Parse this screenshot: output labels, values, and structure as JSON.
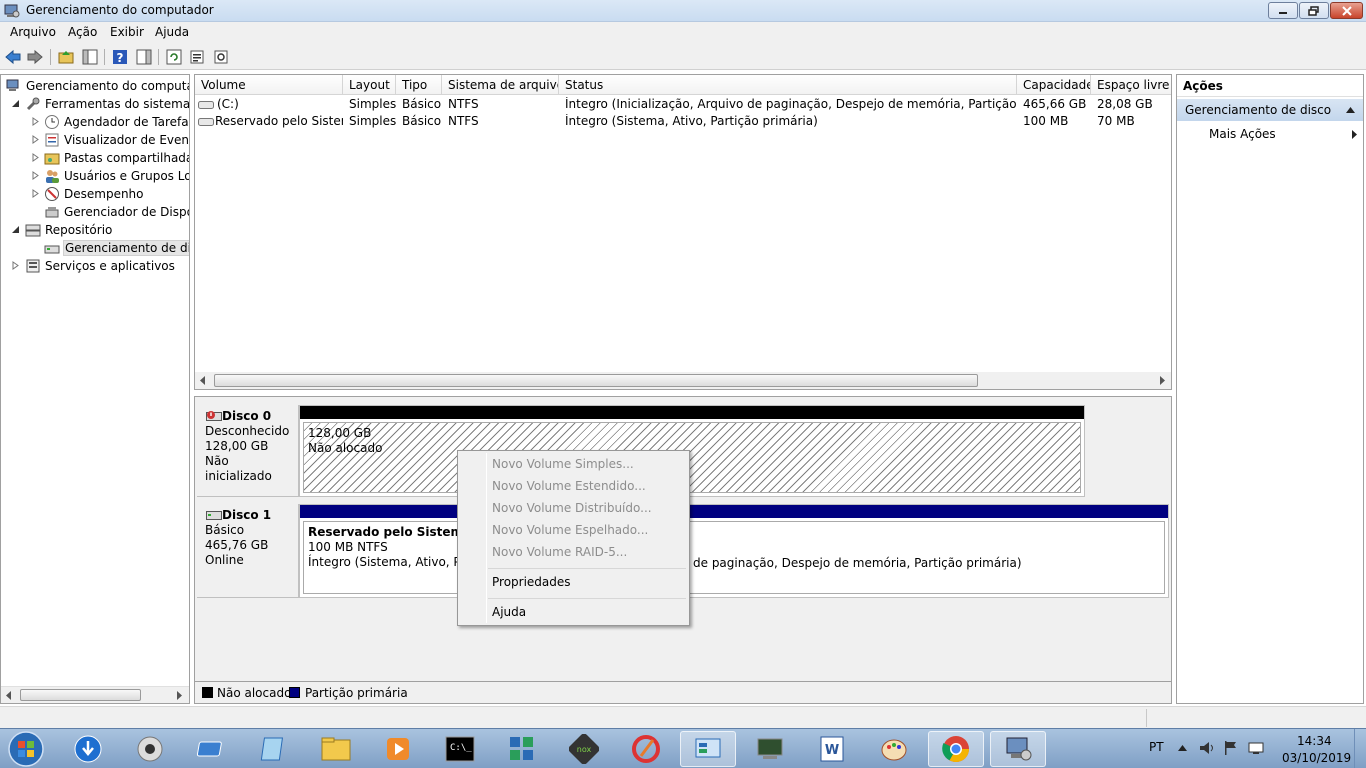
{
  "window": {
    "title": "Gerenciamento do computador"
  },
  "menu": [
    "Arquivo",
    "Ação",
    "Exibir",
    "Ajuda"
  ],
  "tree": {
    "root": "Gerenciamento do computador (Local)",
    "system_tools": "Ferramentas do sistema",
    "task_scheduler": "Agendador de Tarefas",
    "event_viewer": "Visualizador de Eventos",
    "shared_folders": "Pastas compartilhadas",
    "local_users": "Usuários e Grupos Locais",
    "performance": "Desempenho",
    "device_manager": "Gerenciador de Dispositivos",
    "storage": "Repositório",
    "disk_management": "Gerenciamento de disco",
    "services": "Serviços e aplicativos"
  },
  "volumes": {
    "columns": [
      "Volume",
      "Layout",
      "Tipo",
      "Sistema de arquivos",
      "Status",
      "Capacidade",
      "Espaço livre"
    ],
    "rows": [
      {
        "volume": "(C:)",
        "layout": "Simples",
        "type": "Básico",
        "fs": "NTFS",
        "status": "Íntegro (Inicialização, Arquivo de paginação, Despejo de memória, Partição primária)",
        "capacity": "465,66 GB",
        "free": "28,08 GB"
      },
      {
        "volume": "Reservado pelo Sistema",
        "layout": "Simples",
        "type": "Básico",
        "fs": "NTFS",
        "status": "Íntegro (Sistema, Ativo, Partição primária)",
        "capacity": "100 MB",
        "free": "70 MB"
      }
    ]
  },
  "disks": [
    {
      "name": "Disco 0",
      "kind": "Desconhecido",
      "size": "128,00 GB",
      "state": "Não inicializado",
      "part_size": "128,00 GB",
      "part_label": "Não alocado"
    },
    {
      "name": "Disco 1",
      "kind": "Básico",
      "size": "465,76 GB",
      "state": "Online",
      "part_name": "Reservado pelo Sistema",
      "part_size": "100 MB NTFS",
      "part_status": "Íntegro (Sistema, Ativo, Partição primária)",
      "part2_status": "de paginação, Despejo de memória, Partição primária)"
    }
  ],
  "legend": {
    "unallocated": "Não alocado",
    "primary": "Partição primária"
  },
  "actions": {
    "header": "Ações",
    "group": "Gerenciamento de disco",
    "more": "Mais Ações"
  },
  "context_menu": {
    "items": [
      "Novo Volume Simples...",
      "Novo Volume Estendido...",
      "Novo Volume Distribuído...",
      "Novo Volume Espelhado...",
      "Novo Volume RAID-5..."
    ],
    "properties": "Propriedades",
    "help": "Ajuda"
  },
  "tray": {
    "lang": "PT",
    "time": "14:34",
    "date": "03/10/2019"
  },
  "colors": {
    "unallocated": "#000000",
    "primary": "#000080",
    "accent": "#c3d6ec"
  }
}
